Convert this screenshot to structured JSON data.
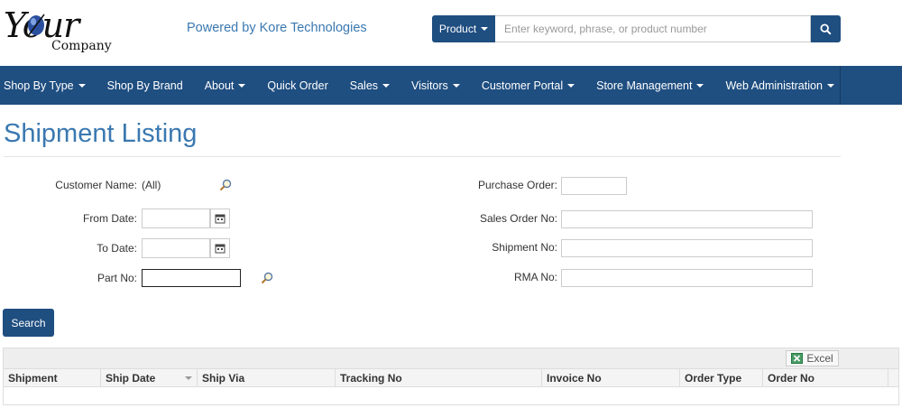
{
  "logo": {
    "main": "Your",
    "sub": "Company"
  },
  "tagline": "Powered by Kore Technologies",
  "search": {
    "scope_label": "Product",
    "placeholder": "Enter keyword, phrase, or product number"
  },
  "nav": {
    "items": [
      {
        "label": "Shop By Type",
        "dropdown": true
      },
      {
        "label": "Shop By Brand",
        "dropdown": false
      },
      {
        "label": "About",
        "dropdown": true
      },
      {
        "label": "Quick Order",
        "dropdown": false
      },
      {
        "label": "Sales",
        "dropdown": true
      },
      {
        "label": "Visitors",
        "dropdown": true
      },
      {
        "label": "Customer Portal",
        "dropdown": true
      },
      {
        "label": "Store Management",
        "dropdown": true
      },
      {
        "label": "Web Administration",
        "dropdown": true
      }
    ]
  },
  "page": {
    "title": "Shipment Listing"
  },
  "form": {
    "customer_name_label": "Customer Name:",
    "customer_name_value": "(All)",
    "from_date_label": "From Date:",
    "from_date_value": "",
    "to_date_label": "To Date:",
    "to_date_value": "",
    "part_no_label": "Part No:",
    "part_no_value": "",
    "purchase_order_label": "Purchase Order:",
    "purchase_order_value": "",
    "sales_order_label": "Sales Order No:",
    "sales_order_value": "",
    "shipment_no_label": "Shipment No:",
    "shipment_no_value": "",
    "rma_no_label": "RMA No:",
    "rma_no_value": "",
    "search_button": "Search"
  },
  "grid": {
    "excel_label": "Excel",
    "columns": [
      "Shipment",
      "Ship Date",
      "Ship Via",
      "Tracking No",
      "Invoice No",
      "Order Type",
      "Order No"
    ],
    "rows": []
  },
  "colors": {
    "brand": "#1f4e80",
    "title": "#3a78b0"
  }
}
